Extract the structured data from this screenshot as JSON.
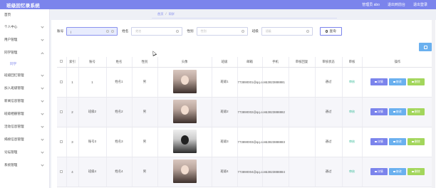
{
  "header": {
    "title": "班级回忆录系统",
    "admin_label": "管理员 abo",
    "back_label": "退出到前台",
    "logout_label": "退出登录"
  },
  "sidebar": {
    "items": [
      {
        "label": "首页"
      },
      {
        "label": "个人中心"
      },
      {
        "label": "用户管理"
      },
      {
        "label": "同学管理"
      },
      {
        "label": "同学"
      },
      {
        "label": "班级回忆管理"
      },
      {
        "label": "加入班级管理"
      },
      {
        "label": "新闻信息管理"
      },
      {
        "label": "班级相册管理"
      },
      {
        "label": "活动信息管理"
      },
      {
        "label": "揭榜信息管理"
      },
      {
        "label": "论坛管理"
      },
      {
        "label": "系统管理"
      }
    ]
  },
  "breadcrumb": {
    "home": "首页",
    "sep": "/",
    "current": "同学"
  },
  "search": {
    "account_label": "账号",
    "account_value": "|",
    "name_label": "姓名",
    "name_placeholder": "姓名",
    "gender_label": "性别",
    "gender_placeholder": "性别",
    "class_label": "班级",
    "class_placeholder": "班级",
    "query_label": "查询"
  },
  "table": {
    "headers": [
      "",
      "索引",
      "账号",
      "姓名",
      "性别",
      "头像",
      "班级",
      "邮箱",
      "手机",
      "审核回复",
      "审核状态",
      "审核",
      "操作"
    ],
    "rows": [
      {
        "index": "1",
        "account": "1",
        "name": "姓名1",
        "gender": "男",
        "class": "班级1",
        "email": "773890001@qq.com",
        "phone": "13823888881",
        "reply": "",
        "status": "通过",
        "audit": "审核"
      },
      {
        "index": "2",
        "account": "班级2",
        "name": "姓名2",
        "gender": "男",
        "class": "班级2",
        "email": "773890002@qq.com",
        "phone": "13823888882",
        "reply": "",
        "status": "通过",
        "audit": "审核"
      },
      {
        "index": "3",
        "account": "账号3",
        "name": "姓名3",
        "gender": "男",
        "class": "班级3",
        "email": "773890003@qq.com",
        "phone": "13823888883",
        "reply": "",
        "status": "通过",
        "audit": "审核"
      },
      {
        "index": "4",
        "account": "班级4",
        "name": "姓名4",
        "gender": "男",
        "class": "班级4",
        "email": "773890004@qq.com",
        "phone": "13823888884",
        "reply": "",
        "status": "通过",
        "audit": "审核"
      }
    ],
    "op_detail": "详情",
    "op_edit": "修改",
    "op_delete": "删除"
  }
}
